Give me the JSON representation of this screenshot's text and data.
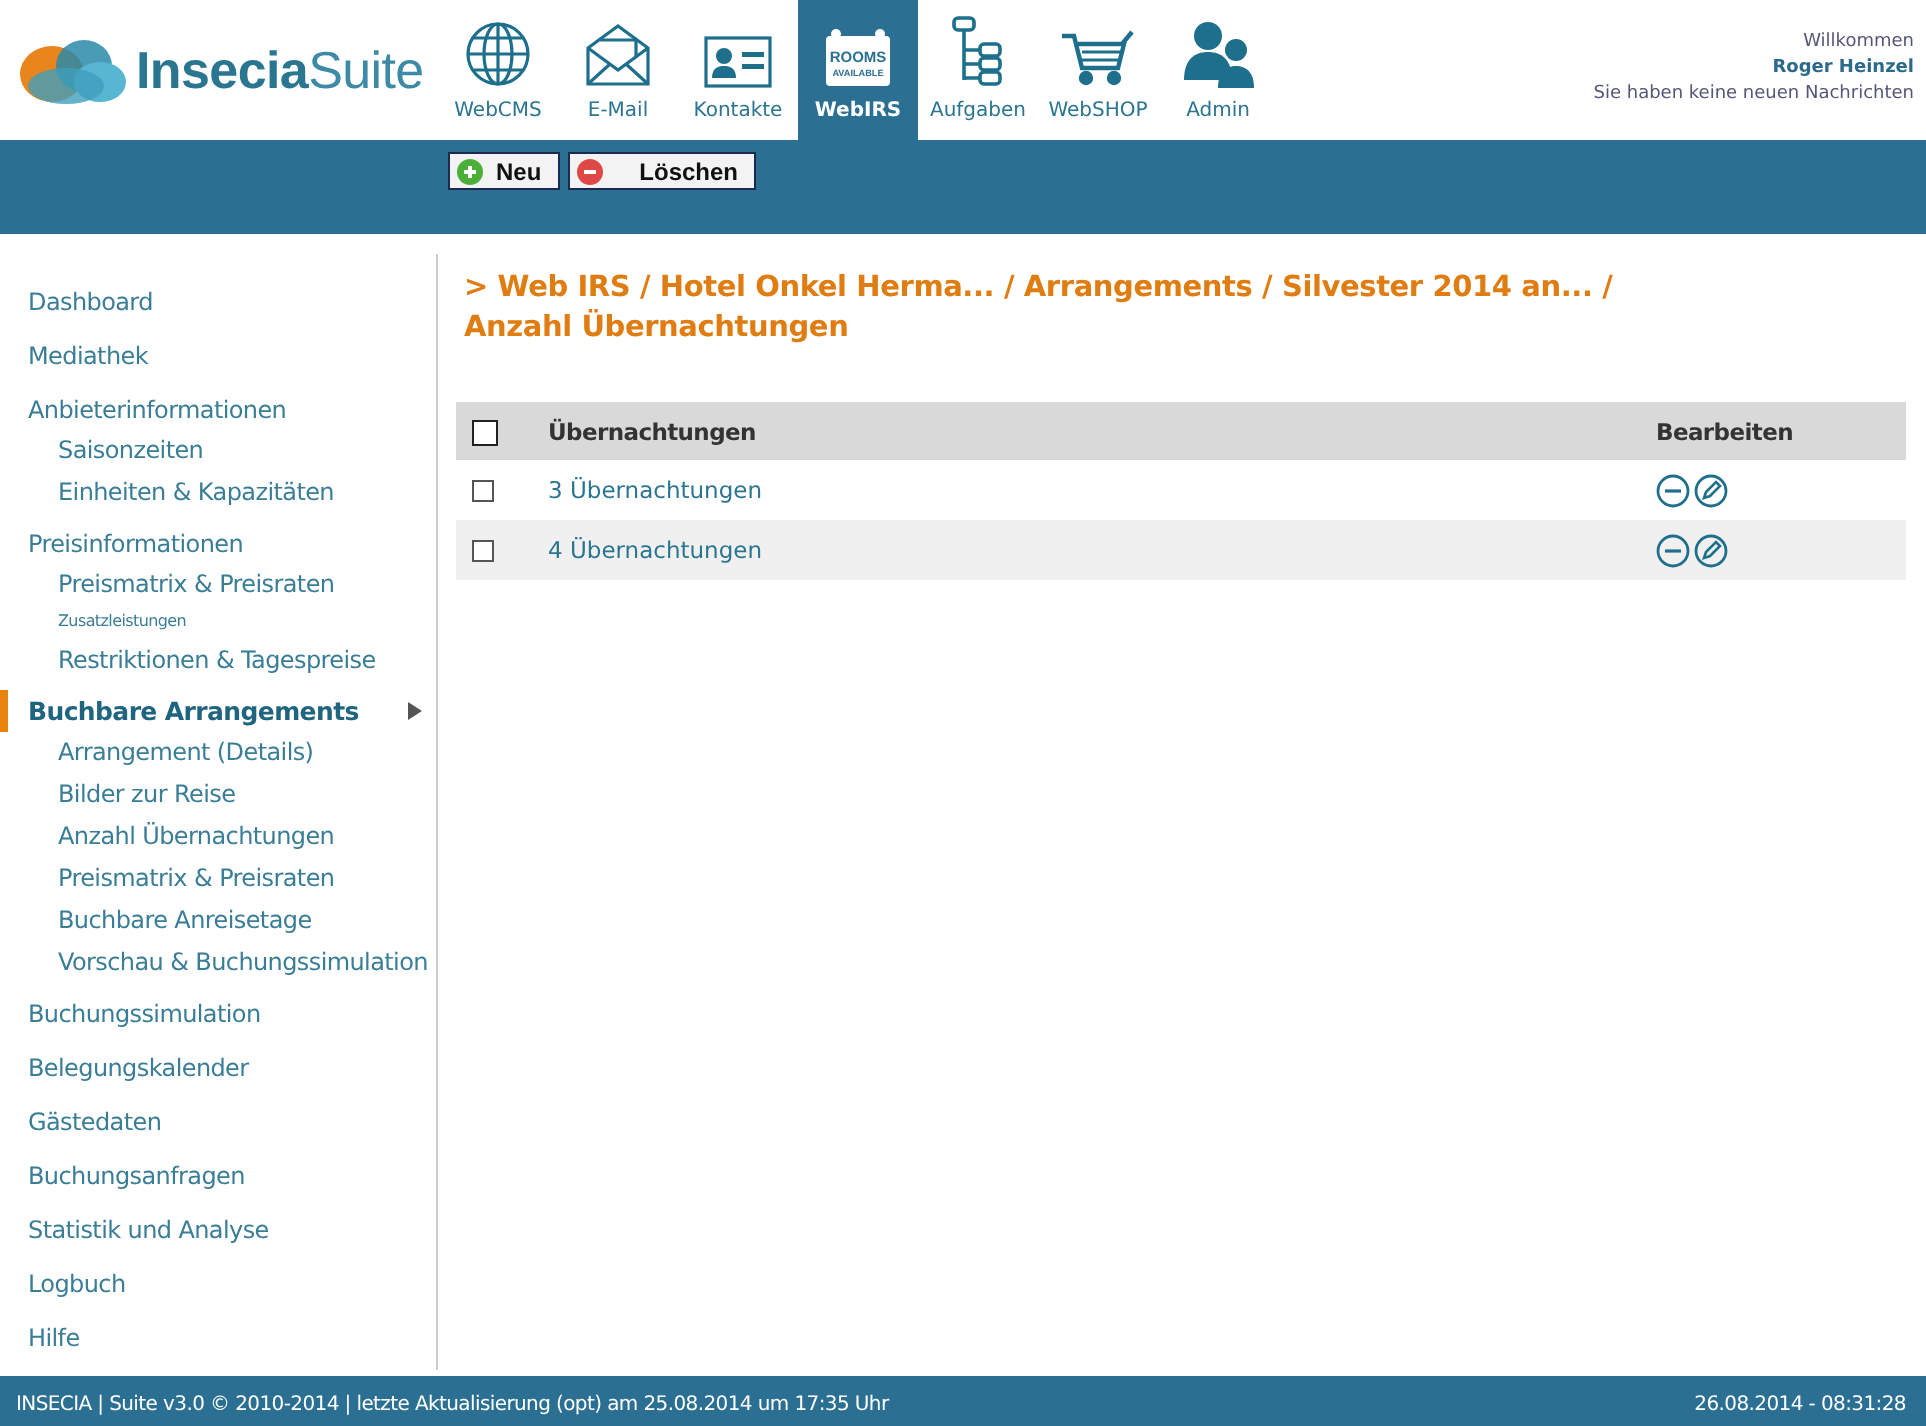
{
  "logo": {
    "bold": "Insecia",
    "light": "Suite"
  },
  "nav": [
    {
      "label": "WebCMS",
      "kind": "globe",
      "selected": false
    },
    {
      "label": "E-Mail",
      "kind": "mail",
      "selected": false
    },
    {
      "label": "Kontakte",
      "kind": "contact",
      "selected": false
    },
    {
      "label": "WebIRS",
      "kind": "rooms",
      "selected": true,
      "sign_text": [
        "ROOMS",
        "AVAILABLE"
      ]
    },
    {
      "label": "Aufgaben",
      "kind": "tree",
      "selected": false
    },
    {
      "label": "WebSHOP",
      "kind": "cart",
      "selected": false
    },
    {
      "label": "Admin",
      "kind": "users",
      "selected": false
    }
  ],
  "user": {
    "greeting": "Willkommen",
    "name": "Roger Heinzel",
    "messages": "Sie haben keine neuen Nachrichten"
  },
  "toolbar": [
    {
      "label": "Neu",
      "kind": "add"
    },
    {
      "label": "Löschen",
      "kind": "delete"
    }
  ],
  "sidebar": {
    "items": [
      {
        "label": "Dashboard",
        "selected": false
      },
      {
        "label": "Mediathek",
        "selected": false
      },
      {
        "label": "Anbieterinformationen",
        "selected": false,
        "children": [
          {
            "label": "Saisonzeiten",
            "kind": "link"
          },
          {
            "label": "Einheiten & Kapazitäten",
            "kind": "link"
          }
        ]
      },
      {
        "label": "Preisinformationen",
        "selected": false,
        "children": [
          {
            "label": "Preismatrix & Preisraten",
            "kind": "link"
          },
          {
            "label": "Zusatzleistungen",
            "kind": "small"
          },
          {
            "label": "Restriktionen & Tagespreise",
            "kind": "link"
          }
        ]
      },
      {
        "label": "Buchbare Arrangements",
        "selected": true,
        "expanded": true,
        "children": [
          {
            "label": "Arrangement (Details)",
            "kind": "link"
          },
          {
            "label": "Bilder zur Reise",
            "kind": "link"
          },
          {
            "label": "Anzahl Übernachtungen",
            "kind": "link"
          },
          {
            "label": "Preismatrix & Preisraten",
            "kind": "link"
          },
          {
            "label": "Buchbare Anreisetage",
            "kind": "link"
          },
          {
            "label": "Vorschau & Buchungssimulation",
            "kind": "link"
          }
        ]
      },
      {
        "label": "Buchungssimulation",
        "selected": false
      },
      {
        "label": "Belegungskalender",
        "selected": false
      },
      {
        "label": "Gästedaten",
        "selected": false
      },
      {
        "label": "Buchungsanfragen",
        "selected": false
      },
      {
        "label": "Statistik und Analyse",
        "selected": false
      },
      {
        "label": "Logbuch",
        "selected": false
      },
      {
        "label": "Hilfe",
        "selected": false
      }
    ]
  },
  "breadcrumb": "> Web IRS / Hotel Onkel Herma... / Arrangements / Silvester 2014 an... / Anzahl Übernachtungen",
  "table": {
    "header_checked": false,
    "columns": [
      "Übernachtungen",
      "Bearbeiten"
    ],
    "rows": [
      {
        "name": "3 Übernachtungen",
        "checked": false
      },
      {
        "name": "4 Übernachtungen",
        "checked": false
      }
    ]
  },
  "status_bar": {
    "left": "INSECIA | Suite v3.0 © 2010-2014 | letzte Aktualisierung (opt) am 25.08.2014 um 17:35 Uhr",
    "right": "26.08.2014 - 08:31:28"
  }
}
